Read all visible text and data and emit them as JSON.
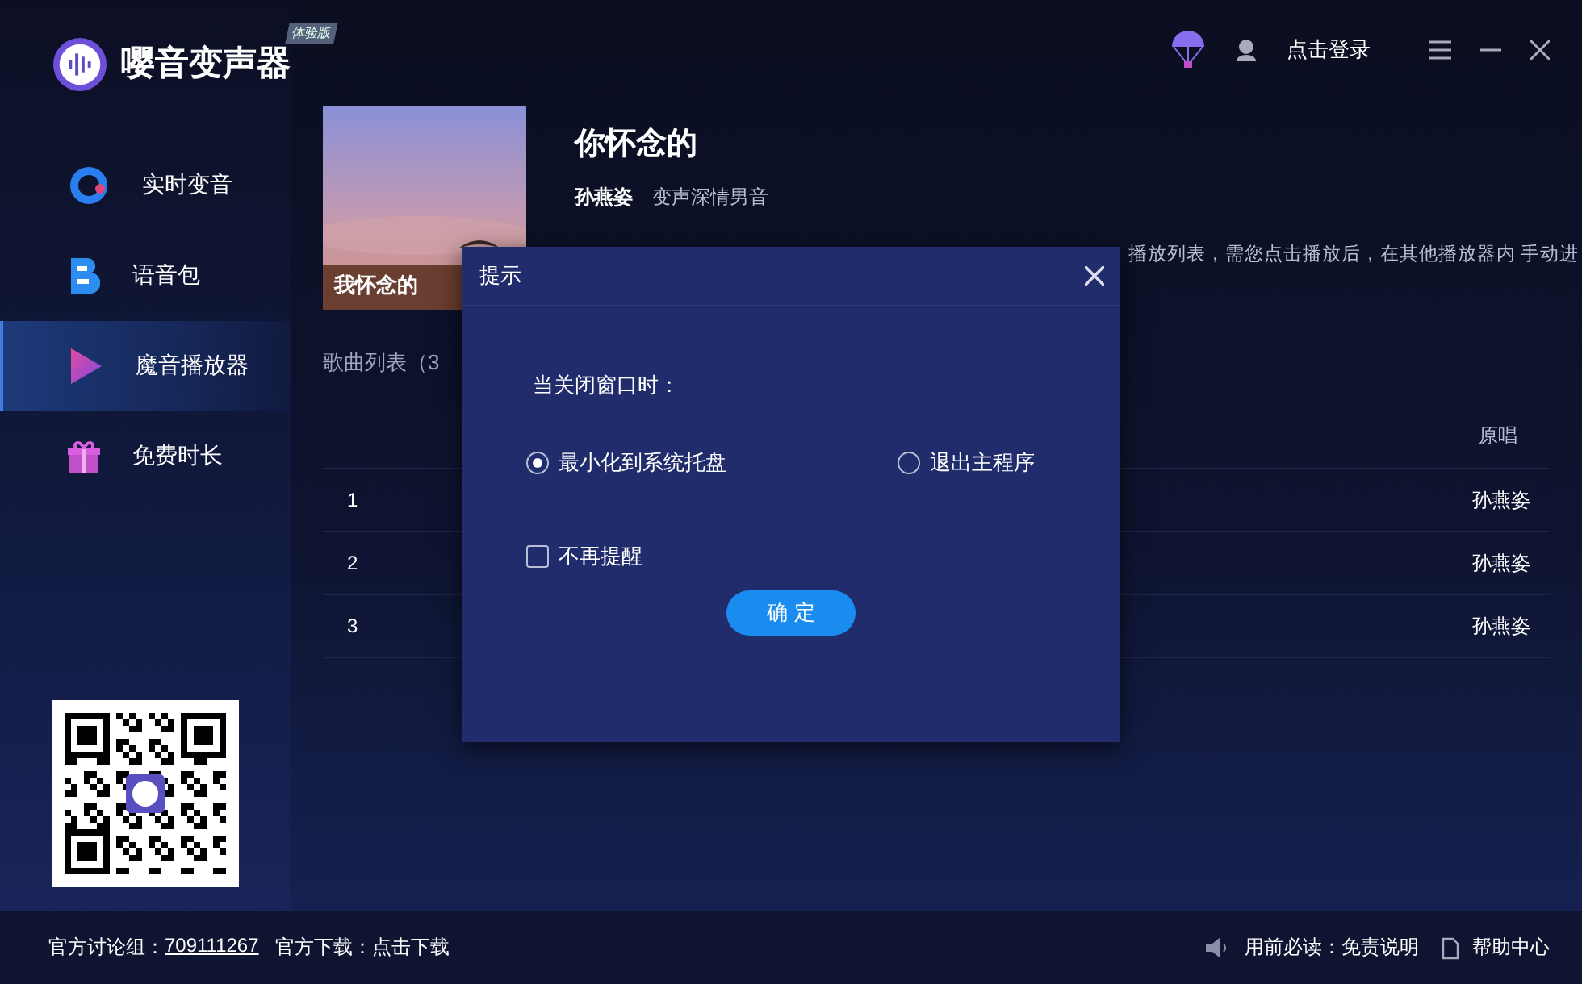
{
  "app": {
    "name": "嘤音变声器",
    "badge": "体验版"
  },
  "header": {
    "login": "点击登录"
  },
  "sidebar": {
    "items": [
      {
        "label": "实时变音",
        "selected": false
      },
      {
        "label": "语音包",
        "selected": false
      },
      {
        "label": "魔音播放器",
        "selected": true
      },
      {
        "label": "免费时长",
        "selected": false
      }
    ]
  },
  "album": {
    "cover_caption": "我怀念的",
    "title": "你怀念的",
    "artist": "孙燕姿",
    "voice": "变声深情男音",
    "description": "播放列表，需您点击播放后，在其他播放器内 手动进"
  },
  "song_list": {
    "heading": "歌曲列表（3",
    "columns": {
      "original_singer": "原唱"
    },
    "rows": [
      {
        "index": "1",
        "original_singer": "孙燕姿"
      },
      {
        "index": "2",
        "original_singer": "孙燕姿"
      },
      {
        "index": "3",
        "original_singer": "孙燕姿"
      }
    ]
  },
  "footer": {
    "group_label": "官方讨论组：",
    "group_number": "709111267",
    "download_label": "官方下载：点击下载",
    "notice": "用前必读：免责说明",
    "help": "帮助中心"
  },
  "dialog": {
    "title": "提示",
    "question": "当关闭窗口时：",
    "options": [
      {
        "label": "最小化到系统托盘",
        "selected": true
      },
      {
        "label": "退出主程序",
        "selected": false
      }
    ],
    "dont_remind": {
      "label": "不再提醒",
      "checked": false
    },
    "confirm": "确 定"
  }
}
